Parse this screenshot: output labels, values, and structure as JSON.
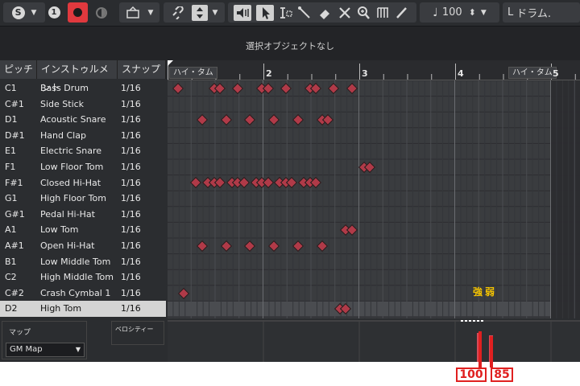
{
  "toolbar": {
    "solo_label": "S",
    "one_label": "1",
    "tempo_value": "100",
    "drum_map_label": "ドラム."
  },
  "status": {
    "text": "選択オブジェクトなし"
  },
  "columns": {
    "pitch": "ピッチ",
    "instrument": "インストゥルメント",
    "snap": "スナップ"
  },
  "instruments": [
    {
      "pitch": "C1",
      "name": "Bass Drum",
      "snap": "1/16"
    },
    {
      "pitch": "C#1",
      "name": "Side Stick",
      "snap": "1/16"
    },
    {
      "pitch": "D1",
      "name": "Acoustic Snare",
      "snap": "1/16"
    },
    {
      "pitch": "D#1",
      "name": "Hand Clap",
      "snap": "1/16"
    },
    {
      "pitch": "E1",
      "name": "Electric Snare",
      "snap": "1/16"
    },
    {
      "pitch": "F1",
      "name": "Low Floor Tom",
      "snap": "1/16"
    },
    {
      "pitch": "F#1",
      "name": "Closed Hi-Hat",
      "snap": "1/16"
    },
    {
      "pitch": "G1",
      "name": "High Floor Tom",
      "snap": "1/16"
    },
    {
      "pitch": "G#1",
      "name": "Pedal Hi-Hat",
      "snap": "1/16"
    },
    {
      "pitch": "A1",
      "name": "Low Tom",
      "snap": "1/16"
    },
    {
      "pitch": "A#1",
      "name": "Open Hi-Hat",
      "snap": "1/16"
    },
    {
      "pitch": "B1",
      "name": "Low Middle Tom",
      "snap": "1/16"
    },
    {
      "pitch": "C2",
      "name": "High Middle Tom",
      "snap": "1/16"
    },
    {
      "pitch": "C#2",
      "name": "Crash Cymbal 1",
      "snap": "1/16"
    },
    {
      "pitch": "D2",
      "name": "High Tom",
      "snap": "1/16"
    }
  ],
  "selected_row": 14,
  "map": {
    "label": "マップ",
    "value": "GM Map"
  },
  "velocity_label": "ベロシティー",
  "ruler": {
    "bars": [
      "2",
      "3",
      "4",
      "5"
    ],
    "markers": [
      "ハイ・タム",
      "ハイ・タム"
    ]
  },
  "annotation": {
    "strong": "強",
    "weak": "弱"
  },
  "callouts": {
    "strong_value": "100",
    "weak_value": "85"
  },
  "colors": {
    "note": "#b03a48",
    "accent": "#e02020",
    "annotation": "#f5c400"
  }
}
